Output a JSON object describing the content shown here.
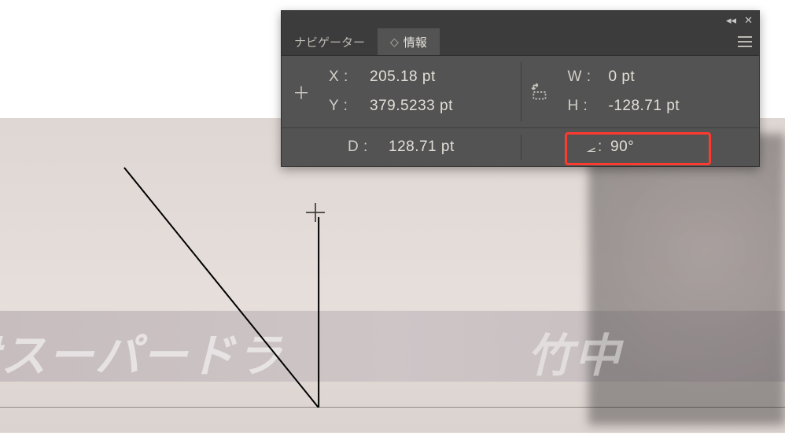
{
  "panel": {
    "tabs": {
      "navigator": "ナビゲーター",
      "info": "情報"
    },
    "xy": {
      "x_label": "X :",
      "x_value": "205.18 pt",
      "y_label": "Y :",
      "y_value": "379.5233 pt"
    },
    "wh": {
      "w_label": "W :",
      "w_value": "0 pt",
      "h_label": "H :",
      "h_value": "-128.71 pt"
    },
    "distance": {
      "d_label": "D :",
      "d_value": "128.71 pt"
    },
    "angle": {
      "a_colon": ":",
      "a_value": "90°"
    },
    "titlebar": {
      "collapse": "◂◂",
      "close": "✕"
    }
  },
  "background": {
    "banner_left": "ｻスーパードラ",
    "banner_right": "竹中"
  },
  "chart_data": {
    "type": "table",
    "title": "Info panel readout",
    "rows": [
      {
        "field": "X",
        "value": 205.18,
        "unit": "pt"
      },
      {
        "field": "Y",
        "value": 379.5233,
        "unit": "pt"
      },
      {
        "field": "W",
        "value": 0,
        "unit": "pt"
      },
      {
        "field": "H",
        "value": -128.71,
        "unit": "pt"
      },
      {
        "field": "D",
        "value": 128.71,
        "unit": "pt"
      },
      {
        "field": "angle",
        "value": 90,
        "unit": "deg"
      }
    ]
  }
}
